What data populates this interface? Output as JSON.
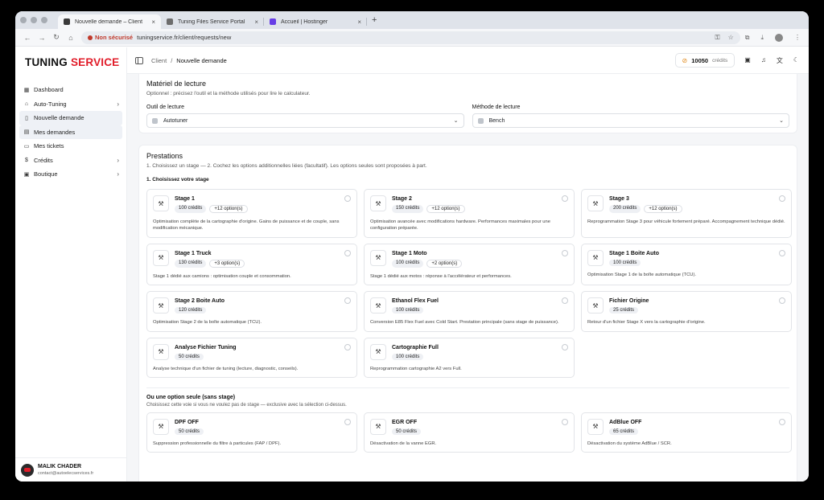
{
  "browser": {
    "tabs": [
      {
        "title": "Nouvelle demande – Client",
        "favicon_color": "#3a3a3a",
        "active": true
      },
      {
        "title": "Tuning Files Service Portal",
        "favicon_color": "#6d6d6d",
        "active": false
      },
      {
        "title": "Accueil | Hostinger",
        "favicon_color": "#673de6",
        "active": false
      }
    ],
    "not_secure_label": "Non sécurisé",
    "url": "tuningservice.fr/client/requests/new"
  },
  "brand": {
    "part1": "TUNING",
    "part2": "SERVICE",
    "accent": "#e11d2a"
  },
  "sidebar": {
    "items": [
      {
        "label": "Dashboard",
        "icon": "dashboard-icon",
        "glyph": "▦",
        "chevron": false,
        "selected": false
      },
      {
        "label": "Auto-Tuning",
        "icon": "car-icon",
        "glyph": "⌂",
        "chevron": true,
        "selected": false
      },
      {
        "label": "Nouvelle demande",
        "icon": "file-icon",
        "glyph": "▯",
        "chevron": false,
        "selected": true
      },
      {
        "label": "Mes demandes",
        "icon": "list-icon",
        "glyph": "▤",
        "chevron": false,
        "selected": true
      },
      {
        "label": "Mes tickets",
        "icon": "ticket-icon",
        "glyph": "▭",
        "chevron": false,
        "selected": false
      },
      {
        "label": "Crédits",
        "icon": "credit-icon",
        "glyph": "$",
        "chevron": true,
        "selected": false
      },
      {
        "label": "Boutique",
        "icon": "shop-icon",
        "glyph": "▣",
        "chevron": true,
        "selected": false
      }
    ],
    "user": {
      "name": "MALIK CHADER",
      "email": "contact@autoelecservices.fr"
    }
  },
  "topbar": {
    "breadcrumb": {
      "parent": "Client",
      "separator": "/",
      "current": "Nouvelle demande"
    },
    "credits": {
      "value": "10050",
      "unit": "crédits"
    }
  },
  "reading": {
    "title": "Matériel de lecture",
    "subtitle": "Optionnel : précisez l'outil et la méthode utilisés pour lire le calculateur.",
    "tool_label": "Outil de lecture",
    "tool_value": "Autotuner",
    "method_label": "Méthode de lecture",
    "method_value": "Bench"
  },
  "prestations": {
    "title": "Prestations",
    "subtitle": "1. Choisissez un stage — 2. Cochez les options additionnelles liées (facultatif). Les options seules sont proposées à part.",
    "step1": "1. Choisissez votre stage",
    "stages": [
      {
        "name": "Stage 1",
        "price": "100 crédits",
        "options": "+12 option(s)",
        "desc": "Optimisation complète de la cartographie d'origine. Gains de puissance et de couple, sans modification mécanique."
      },
      {
        "name": "Stage 2",
        "price": "150 crédits",
        "options": "+12 option(s)",
        "desc": "Optimisation avancée avec modifications hardware. Performances maximales pour une configuration préparée."
      },
      {
        "name": "Stage 3",
        "price": "200 crédits",
        "options": "+12 option(s)",
        "desc": "Reprogrammation Stage 3 pour véhicule fortement préparé. Accompagnement technique dédié."
      },
      {
        "name": "Stage 1 Truck",
        "price": "130 crédits",
        "options": "+3 option(s)",
        "desc": "Stage 1 dédié aux camions : optimisation couple et consommation."
      },
      {
        "name": "Stage 1 Moto",
        "price": "100 crédits",
        "options": "+2 option(s)",
        "desc": "Stage 1 dédié aux motos : réponse à l'accélérateur et performances."
      },
      {
        "name": "Stage 1 Boite Auto",
        "price": "100 crédits",
        "options": "",
        "desc": "Optimisation Stage 1 de la boîte automatique (TCU)."
      },
      {
        "name": "Stage 2 Boite Auto",
        "price": "120 crédits",
        "options": "",
        "desc": "Optimisation Stage 2 de la boîte automatique (TCU)."
      },
      {
        "name": "Ethanol Flex Fuel",
        "price": "100 crédits",
        "options": "",
        "desc": "Conversion E85 Flex Fuel avec Cold Start. Prestation principale (sans stage de puissance)."
      },
      {
        "name": "Fichier Origine",
        "price": "25 crédits",
        "options": "",
        "desc": "Retour d'un fichier Stage X vers la cartographie d'origine."
      },
      {
        "name": "Analyse Fichier Tuning",
        "price": "50 crédits",
        "options": "",
        "desc": "Analyse technique d'un fichier de tuning (lecture, diagnostic, conseils)."
      },
      {
        "name": "Cartographie Full",
        "price": "100 crédits",
        "options": "",
        "desc": "Reprogrammation cartographie A2 vers Full."
      }
    ],
    "alt_title": "Ou une option seule (sans stage)",
    "alt_subtitle": "Choisissez cette voie si vous ne voulez pas de stage — exclusive avec la sélection ci-dessus.",
    "single_options": [
      {
        "name": "DPF OFF",
        "price": "50 crédits",
        "desc": "Suppression professionnelle du filtre à particules (FAP / DPF)."
      },
      {
        "name": "EGR OFF",
        "price": "50 crédits",
        "desc": "Désactivation de la vanne EGR."
      },
      {
        "name": "AdBlue OFF",
        "price": "65 crédits",
        "desc": "Désactivation du système AdBlue / SCR."
      }
    ]
  }
}
